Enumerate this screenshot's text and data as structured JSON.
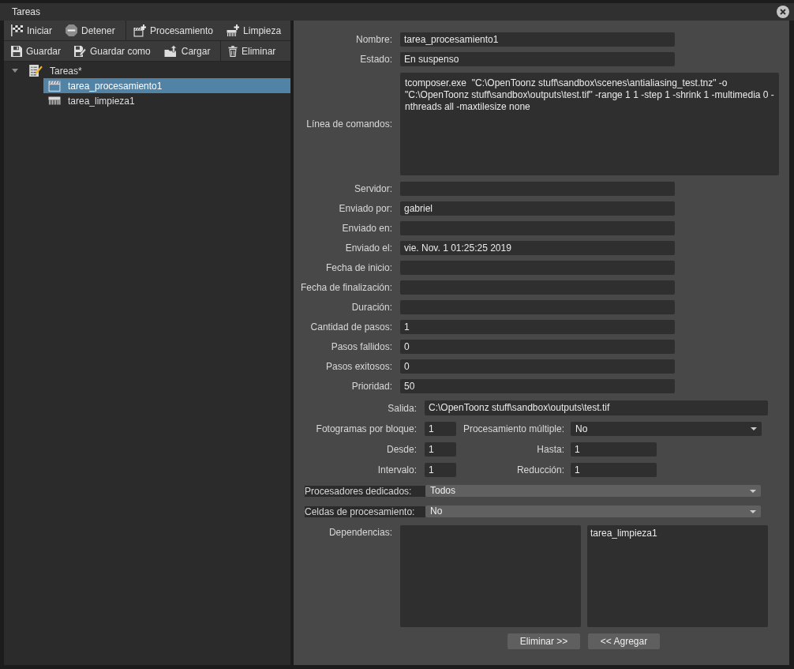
{
  "window": {
    "title": "Tareas"
  },
  "toolbar": [
    {
      "groups": [
        [
          {
            "label": "Iniciar"
          },
          {
            "label": "Detener"
          }
        ],
        [
          {
            "label": "Procesamiento"
          },
          {
            "label": "Limpieza"
          }
        ]
      ]
    },
    {
      "groups": [
        [
          {
            "label": "Guardar"
          },
          {
            "label": "Guardar como"
          },
          {
            "label": "Cargar"
          }
        ],
        [
          {
            "label": "Eliminar"
          }
        ]
      ]
    }
  ],
  "tree": {
    "label": "Tareas*",
    "expanded": true,
    "children": [
      {
        "label": "tarea_procesamiento1",
        "kind": "render",
        "selected": true
      },
      {
        "label": "tarea_limpieza1",
        "kind": "cleanup",
        "selected": false
      }
    ]
  },
  "details": {
    "fields": [
      {
        "label": "Nombre:",
        "kind": "line",
        "value": "tarea_procesamiento1"
      },
      {
        "label": "Estado:",
        "kind": "line",
        "value": "En suspenso"
      },
      {
        "label": "Línea de comandos:",
        "kind": "multiline",
        "value": "tcomposer.exe  \"C:\\OpenToonz stuff\\sandbox\\scenes\\antialiasing_test.tnz\" -o \"C:\\OpenToonz stuff\\sandbox\\outputs\\test.tif\" -range 1 1 -step 1 -shrink 1 -multimedia 0 -nthreads all -maxtilesize none"
      },
      {
        "label": "Servidor:",
        "kind": "line"
      },
      {
        "label": "Enviado por:",
        "kind": "line",
        "value": "gabriel"
      },
      {
        "label": "Enviado en:",
        "kind": "line"
      },
      {
        "label": "Enviado el:",
        "kind": "line",
        "value": "vie. Nov. 1 01:25:25 2019"
      },
      {
        "label": "Fecha de inicio:",
        "kind": "line"
      },
      {
        "label": "Fecha de finalización:",
        "kind": "line"
      },
      {
        "label": "Duración:",
        "kind": "line"
      },
      {
        "label": "Cantidad de pasos:",
        "kind": "line",
        "value": "1"
      },
      {
        "label": "Pasos fallidos:",
        "kind": "line",
        "value": "0"
      },
      {
        "label": "Pasos exitosos:",
        "kind": "line",
        "value": "0"
      },
      {
        "label": "Prioridad:",
        "kind": "line",
        "value": "50"
      }
    ],
    "output": {
      "label": "Salida:",
      "value": "C:\\OpenToonz stuff\\sandbox\\outputs\\test.tif"
    },
    "frames_per_chunk": {
      "label": "Fotogramas por bloque:",
      "value": "1"
    },
    "multiple_rendering": {
      "label": "Procesamiento múltiple:",
      "value": "No"
    },
    "from": {
      "label": "Desde:",
      "value": "1"
    },
    "to": {
      "label": "Hasta:",
      "value": "1"
    },
    "step": {
      "label": "Intervalo:",
      "value": "1"
    },
    "shrink": {
      "label": "Reducción:",
      "value": "1"
    },
    "dedicated_cpus": {
      "label": "Procesadores dedicados:",
      "value": "Todos"
    },
    "render_tile": {
      "label": "Celdas de procesamiento:",
      "value": "No"
    },
    "dependencies": {
      "label": "Dependencias:",
      "right_list": [
        "tarea_limpieza1"
      ]
    },
    "buttons": [
      {
        "label": "Eliminar >>"
      },
      {
        "label": "<< Agregar"
      }
    ]
  }
}
